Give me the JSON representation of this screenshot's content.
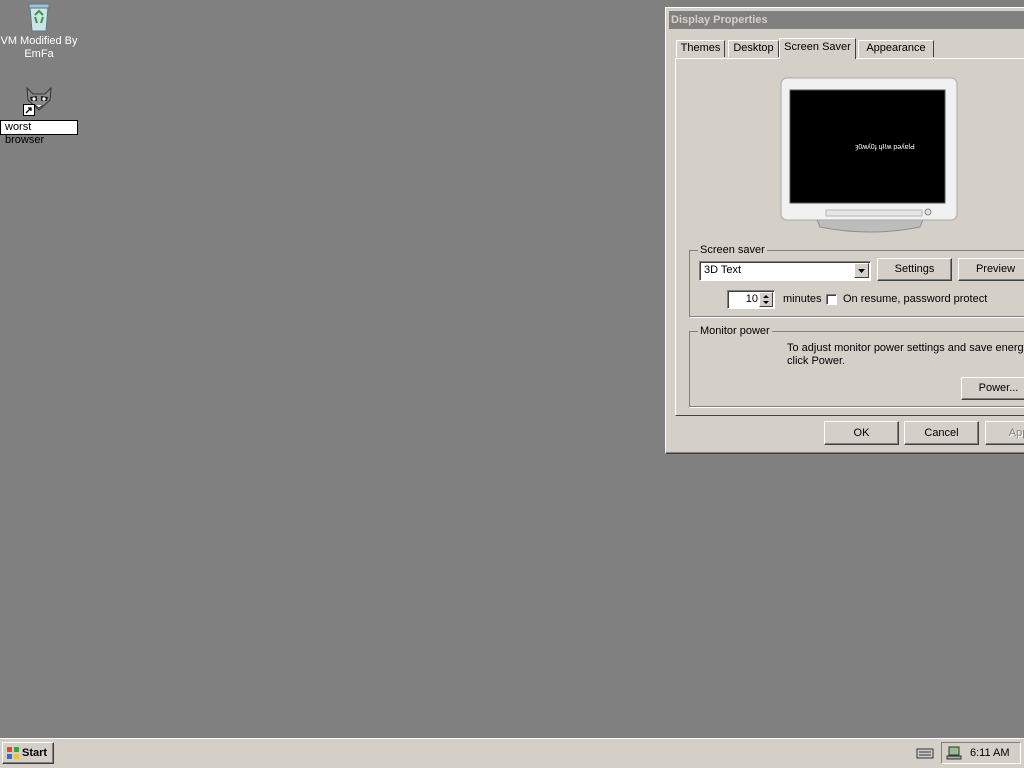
{
  "desktop": {
    "icons": [
      {
        "label": "VM Modified By EmFa",
        "icon": "recycle-bin-icon"
      },
      {
        "label": "worst browser",
        "icon": "raccoon-shortcut-icon"
      }
    ],
    "rename_text": "worst browser"
  },
  "dialog": {
    "title": "Display Properties",
    "tabs": [
      {
        "label": "Themes"
      },
      {
        "label": "Desktop"
      },
      {
        "label": "Screen Saver",
        "active": true
      },
      {
        "label": "Appearance"
      }
    ],
    "preview_text": "ȝ0ʍʎ0ɟ ɥʇ!ʍ pǝʎɐlԀ",
    "screensaver": {
      "group_label": "Screen saver",
      "selected": "3D Text",
      "settings_button": "Settings",
      "preview_button": "Preview",
      "wait_value": "10",
      "minutes_label": "minutes",
      "password_checkbox_label": "On resume, password protect",
      "password_checked": false
    },
    "monitor_power": {
      "group_label": "Monitor power",
      "description_line1": "To adjust monitor power settings and save energy,",
      "description_line2": "click Power.",
      "power_button": "Power..."
    },
    "buttons": {
      "ok": "OK",
      "cancel": "Cancel",
      "apply": "Apply"
    }
  },
  "taskbar": {
    "start_label": "Start",
    "clock": "6:11 AM"
  },
  "colors": {
    "desktop": "#808080",
    "dialog_face": "#d4d0c8",
    "inactive_titlebar": "#808080"
  }
}
